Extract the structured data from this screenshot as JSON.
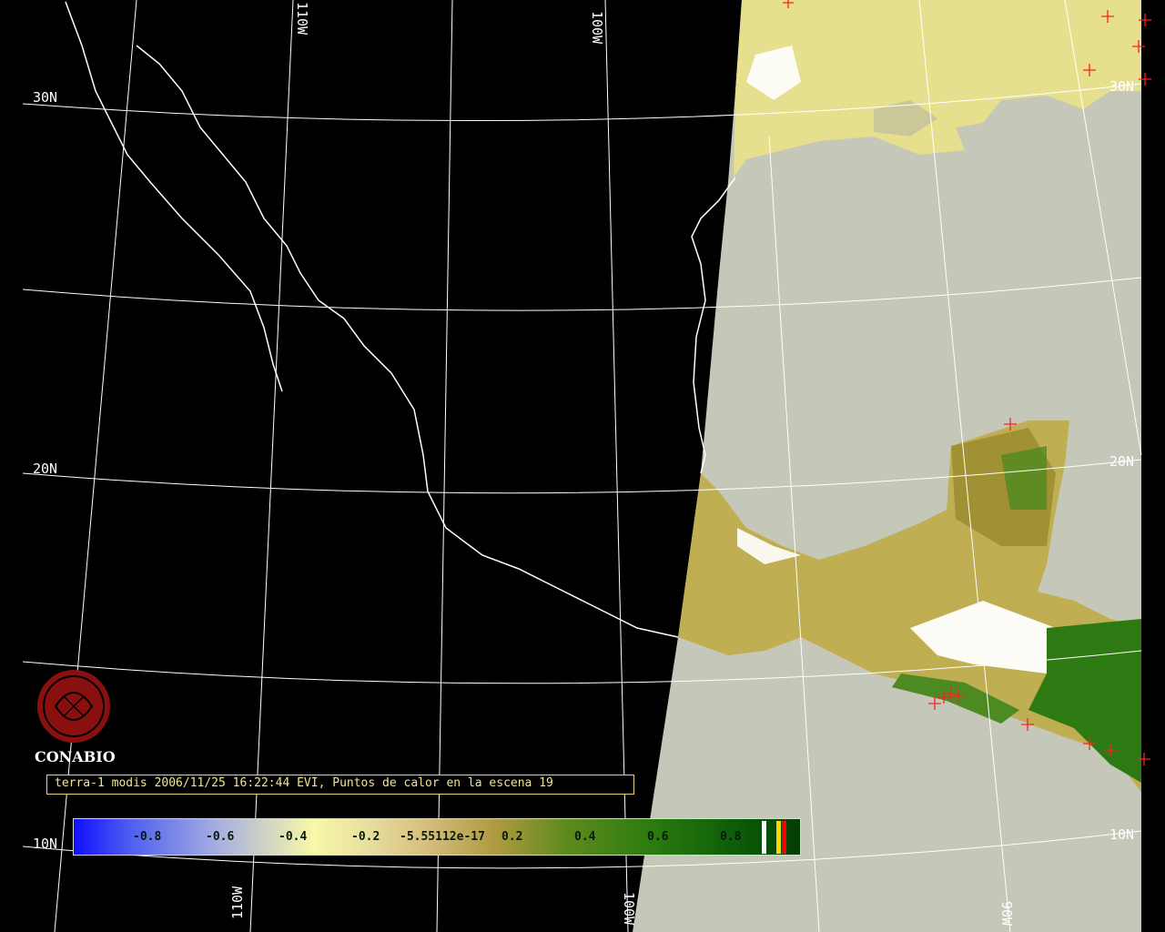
{
  "title": "terra-1 modis 2006/11/25 16:22:44 EVI, Puntos de calor en la escena 19",
  "logo": {
    "name": "CONABIO"
  },
  "grid_labels": {
    "lat_30n_left": "30N",
    "lat_20n_left": "20N",
    "lat_10n_left": "10N",
    "lat_20n_right": "20N",
    "lat_10n_right": "10N",
    "lat_30n_right": "30N",
    "lon_110w_top": "110W",
    "lon_100w_top": "100W",
    "lon_110w_bottom": "110W",
    "lon_100w_bottom": "100W",
    "lon_90w_bottom": "90W"
  },
  "colorbar": {
    "ticks": [
      "-0.8",
      "-0.6",
      "-0.4",
      "-0.2",
      "-5.55112e-17",
      "0.2",
      "0.4",
      "0.6",
      "0.8"
    ],
    "extra_swatches": [
      "#ffffff",
      "#ffd700",
      "#ff0000"
    ]
  },
  "colors": {
    "ocean_data": "#c5c7b8",
    "outside_swath": "#000000",
    "graticule": "#ffffff",
    "hotspot": "#ff2020",
    "cloud": "#ffffff"
  },
  "hotspot_count_label": "19"
}
